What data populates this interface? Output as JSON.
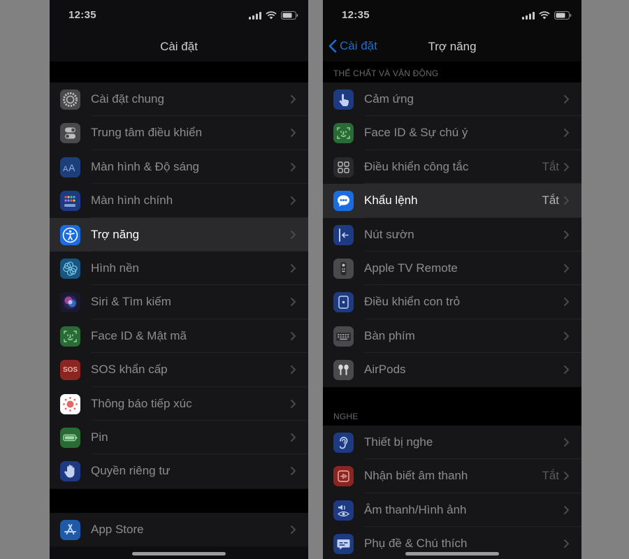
{
  "left": {
    "status": {
      "time": "12:35"
    },
    "nav": {
      "title": "Cài đặt"
    },
    "groups": [
      [
        {
          "label": "Cài đặt chung",
          "icon": "gear-icon",
          "color": "#4a4a4d"
        },
        {
          "label": "Trung tâm điều khiển",
          "icon": "toggles-icon",
          "color": "#4a4a4d"
        },
        {
          "label": "Màn hình & Độ sáng",
          "icon": "text-size-icon",
          "color": "#1c3f7a"
        },
        {
          "label": "Màn hình chính",
          "icon": "app-grid-icon",
          "color": "#1e3a82"
        },
        {
          "label": "Trợ năng",
          "icon": "accessibility-icon",
          "color": "#1a6de0",
          "selected": true
        },
        {
          "label": "Hình nền",
          "icon": "flower-icon",
          "color": "#19557e"
        },
        {
          "label": "Siri & Tìm kiếm",
          "icon": "siri-icon",
          "color": "#1a1a2e"
        },
        {
          "label": "Face ID & Mật mã",
          "icon": "face-id-icon",
          "color": "#2a6a34"
        },
        {
          "label": "SOS khẩn cấp",
          "icon": "sos-icon",
          "color": "#8a2520",
          "text": "SOS"
        },
        {
          "label": "Thông báo tiếp xúc",
          "icon": "exposure-icon",
          "color": "#ffffff"
        },
        {
          "label": "Pin",
          "icon": "battery-icon",
          "color": "#2a6a34"
        },
        {
          "label": "Quyền riêng tư",
          "icon": "hand-icon",
          "color": "#1e3a82"
        }
      ],
      [
        {
          "label": "App Store",
          "icon": "app-store-icon",
          "color": "#1e5aa8"
        }
      ]
    ]
  },
  "right": {
    "status": {
      "time": "12:35"
    },
    "nav": {
      "back_label": "Cài đặt",
      "title": "Trợ năng"
    },
    "sections": [
      {
        "header": "THỂ CHẤT VÀ VẬN ĐỘNG",
        "items": [
          {
            "label": "Cảm ứng",
            "icon": "touch-hand-icon",
            "color": "#1e3a82"
          },
          {
            "label": "Face ID & Sự chú ý",
            "icon": "face-id-icon",
            "color": "#2a6a34"
          },
          {
            "label": "Điều khiển công tắc",
            "icon": "switch-grid-icon",
            "color": "#2a2a2d",
            "value": "Tắt"
          },
          {
            "label": "Khẩu lệnh",
            "icon": "voice-control-icon",
            "color": "#1a6de0",
            "value": "Tắt",
            "selected": true
          },
          {
            "label": "Nút sườn",
            "icon": "side-button-icon",
            "color": "#1e3a82"
          },
          {
            "label": "Apple TV Remote",
            "icon": "remote-icon",
            "color": "#4a4a4d"
          },
          {
            "label": "Điều khiển con trỏ",
            "icon": "pointer-icon",
            "color": "#1e3a82"
          },
          {
            "label": "Bàn phím",
            "icon": "keyboard-icon",
            "color": "#4a4a4d"
          },
          {
            "label": "AirPods",
            "icon": "airpods-icon",
            "color": "#4a4a4d"
          }
        ]
      },
      {
        "header": "NGHE",
        "items": [
          {
            "label": "Thiết bị nghe",
            "icon": "ear-icon",
            "color": "#1e3a82"
          },
          {
            "label": "Nhận biết âm thanh",
            "icon": "sound-recognition-icon",
            "color": "#8a2520",
            "value": "Tắt"
          },
          {
            "label": "Âm thanh/Hình ảnh",
            "icon": "audio-visual-icon",
            "color": "#1e3a82"
          },
          {
            "label": "Phụ đề & Chú thích",
            "icon": "subtitles-icon",
            "color": "#1e3a82"
          }
        ]
      }
    ]
  }
}
